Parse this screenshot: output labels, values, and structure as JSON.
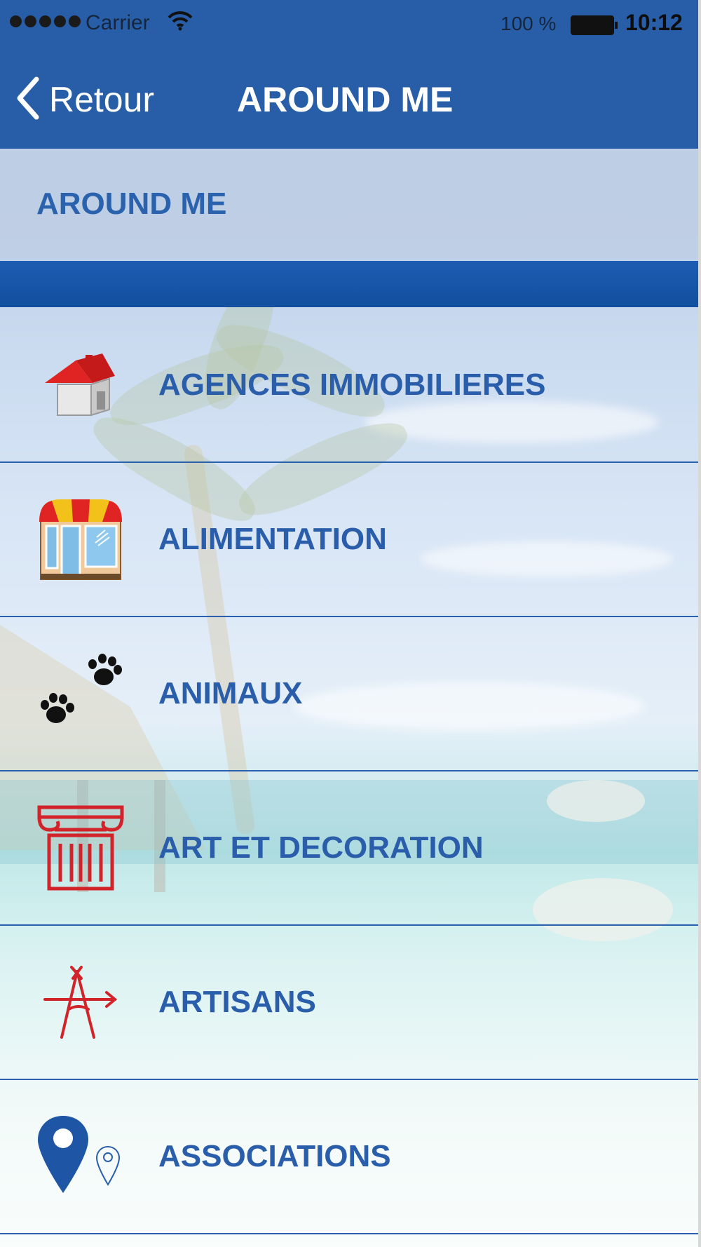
{
  "status_bar": {
    "carrier": "Carrier",
    "battery": "100 %",
    "time": "10:12"
  },
  "nav": {
    "back_label": "Retour",
    "title": "AROUND ME"
  },
  "section": {
    "title": "AROUND ME"
  },
  "categories": [
    {
      "label": "AGENCES IMMOBILIERES",
      "icon": "house-icon"
    },
    {
      "label": "ALIMENTATION",
      "icon": "shop-icon"
    },
    {
      "label": "ANIMAUX",
      "icon": "paw-icon"
    },
    {
      "label": "ART ET DECORATION",
      "icon": "column-icon"
    },
    {
      "label": "ARTISANS",
      "icon": "compass-tools-icon"
    },
    {
      "label": "ASSOCIATIONS",
      "icon": "map-pin-icon"
    }
  ],
  "colors": {
    "nav_blue": "#285ea8",
    "text_blue": "#2a5eaa",
    "icon_red": "#d2232a"
  }
}
